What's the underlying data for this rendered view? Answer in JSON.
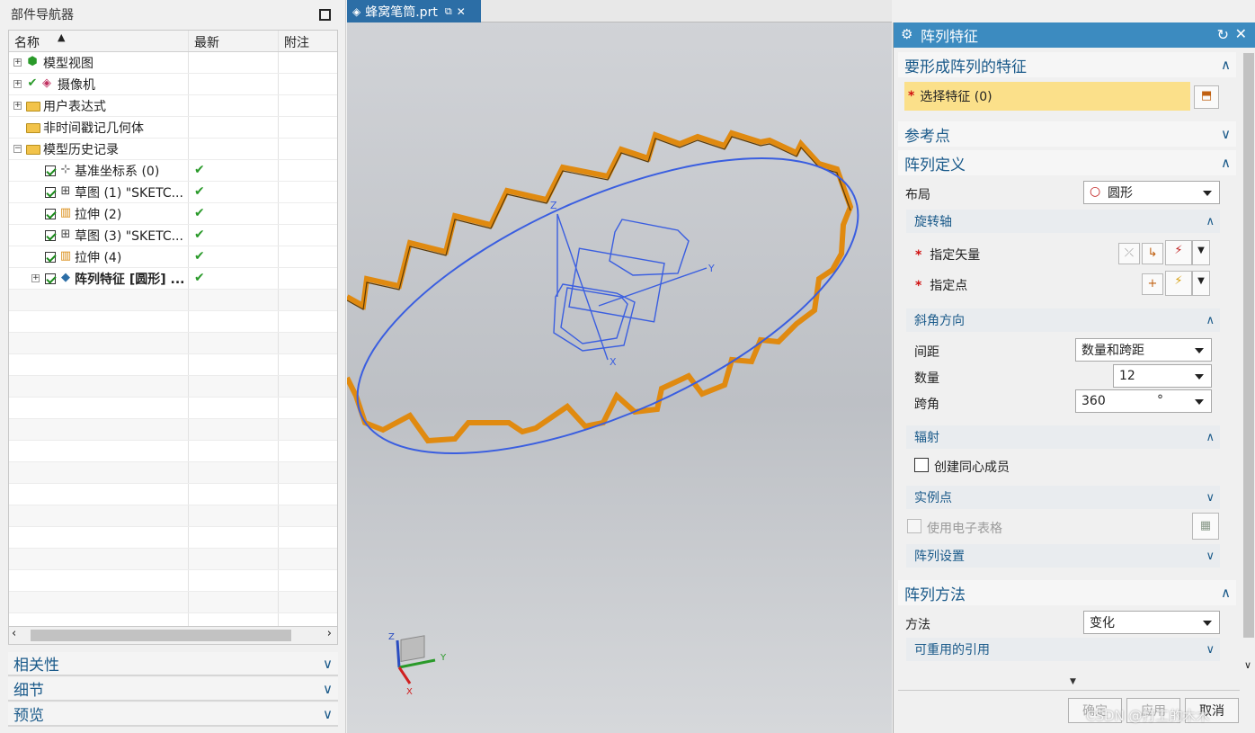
{
  "navigator": {
    "title": "部件导航器",
    "columns": [
      "名称",
      "最新",
      "附注"
    ],
    "items": [
      {
        "label": "模型视图",
        "level": 0
      },
      {
        "label": "摄像机",
        "level": 0
      },
      {
        "label": "用户表达式",
        "level": 0
      },
      {
        "label": "非时间戳记几何体",
        "level": 0
      },
      {
        "label": "模型历史记录",
        "level": 0
      },
      {
        "label": "基准坐标系 (0)",
        "level": 1,
        "ok": "✔"
      },
      {
        "label": "草图 (1) \"SKETC...",
        "level": 1,
        "ok": "✔"
      },
      {
        "label": "拉伸 (2)",
        "level": 1,
        "ok": "✔"
      },
      {
        "label": "草图 (3) \"SKETC...",
        "level": 1,
        "ok": "✔"
      },
      {
        "label": "拉伸 (4)",
        "level": 1,
        "ok": "✔"
      },
      {
        "label": "阵列特征 [圆形] ...",
        "level": 1,
        "ok": "✔",
        "bold": true
      }
    ],
    "sections": [
      "相关性",
      "细节",
      "预览"
    ]
  },
  "viewport": {
    "tab_label": "蜂窝笔筒.prt",
    "axes": {
      "z": "Z",
      "y": "Y",
      "x": "X"
    }
  },
  "dialog": {
    "title": "阵列特征",
    "sec_features": "要形成阵列的特征",
    "select_feature": "选择特征 (0)",
    "sec_ref": "参考点",
    "sec_def": "阵列定义",
    "layout_label": "布局",
    "layout_value": "圆形",
    "sub_axis": "旋转轴",
    "specify_vector": "指定矢量",
    "specify_point": "指定点",
    "sub_angle": "斜角方向",
    "spacing_label": "间距",
    "spacing_value": "数量和跨距",
    "count_label": "数量",
    "count_value": "12",
    "span_label": "跨角",
    "span_value": "360",
    "span_unit": "°",
    "sub_radiate": "辐射",
    "create_concentric": "创建同心成员",
    "sub_instance": "实例点",
    "use_spreadsheet": "使用电子表格",
    "sub_settings": "阵列设置",
    "sec_method": "阵列方法",
    "method_label": "方法",
    "method_value": "变化",
    "sub_reuse": "可重用的引用",
    "ok": "确定",
    "apply": "应用",
    "cancel": "取消"
  },
  "watermark": "CSDN @打工的木木",
  "colors": {
    "accent": "#3c8bc0",
    "highlight": "#fbe08a",
    "model": "#e08a10",
    "sketch": "#3a5ee0"
  }
}
